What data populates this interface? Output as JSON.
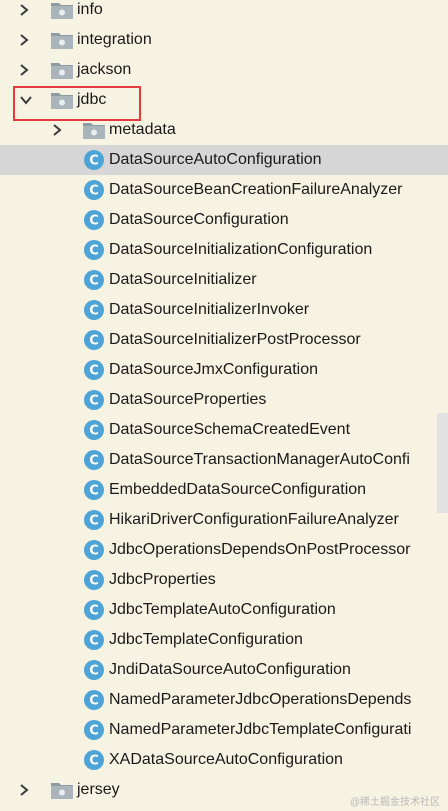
{
  "tree": {
    "items": [
      {
        "label": "info",
        "type": "package",
        "expanded": false
      },
      {
        "label": "integration",
        "type": "package",
        "expanded": false
      },
      {
        "label": "jackson",
        "type": "package",
        "expanded": false
      },
      {
        "label": "jdbc",
        "type": "package",
        "expanded": true
      },
      {
        "label": "metadata",
        "type": "package",
        "expanded": false
      },
      {
        "label": "DataSourceAutoConfiguration",
        "type": "class",
        "selected": true
      },
      {
        "label": "DataSourceBeanCreationFailureAnalyzer",
        "type": "class"
      },
      {
        "label": "DataSourceConfiguration",
        "type": "class"
      },
      {
        "label": "DataSourceInitializationConfiguration",
        "type": "class"
      },
      {
        "label": "DataSourceInitializer",
        "type": "class"
      },
      {
        "label": "DataSourceInitializerInvoker",
        "type": "class"
      },
      {
        "label": "DataSourceInitializerPostProcessor",
        "type": "class"
      },
      {
        "label": "DataSourceJmxConfiguration",
        "type": "class"
      },
      {
        "label": "DataSourceProperties",
        "type": "class"
      },
      {
        "label": "DataSourceSchemaCreatedEvent",
        "type": "class"
      },
      {
        "label": "DataSourceTransactionManagerAutoConfi",
        "type": "class"
      },
      {
        "label": "EmbeddedDataSourceConfiguration",
        "type": "class"
      },
      {
        "label": "HikariDriverConfigurationFailureAnalyzer",
        "type": "class"
      },
      {
        "label": "JdbcOperationsDependsOnPostProcessor",
        "type": "class"
      },
      {
        "label": "JdbcProperties",
        "type": "class"
      },
      {
        "label": "JdbcTemplateAutoConfiguration",
        "type": "class"
      },
      {
        "label": "JdbcTemplateConfiguration",
        "type": "class"
      },
      {
        "label": "JndiDataSourceAutoConfiguration",
        "type": "class"
      },
      {
        "label": "NamedParameterJdbcOperationsDepends",
        "type": "class"
      },
      {
        "label": "NamedParameterJdbcTemplateConfigurati",
        "type": "class"
      },
      {
        "label": "XADataSourceAutoConfiguration",
        "type": "class"
      },
      {
        "label": "jersey",
        "type": "package",
        "expanded": false
      }
    ]
  },
  "watermark": "@稀土掘金技术社区",
  "colors": {
    "background": "#f6f3e3",
    "selected_row": "#d6d6d6",
    "highlight_border": "#e5393c",
    "class_icon": "#4ea4d6",
    "folder_icon": "#8f9ba3"
  }
}
